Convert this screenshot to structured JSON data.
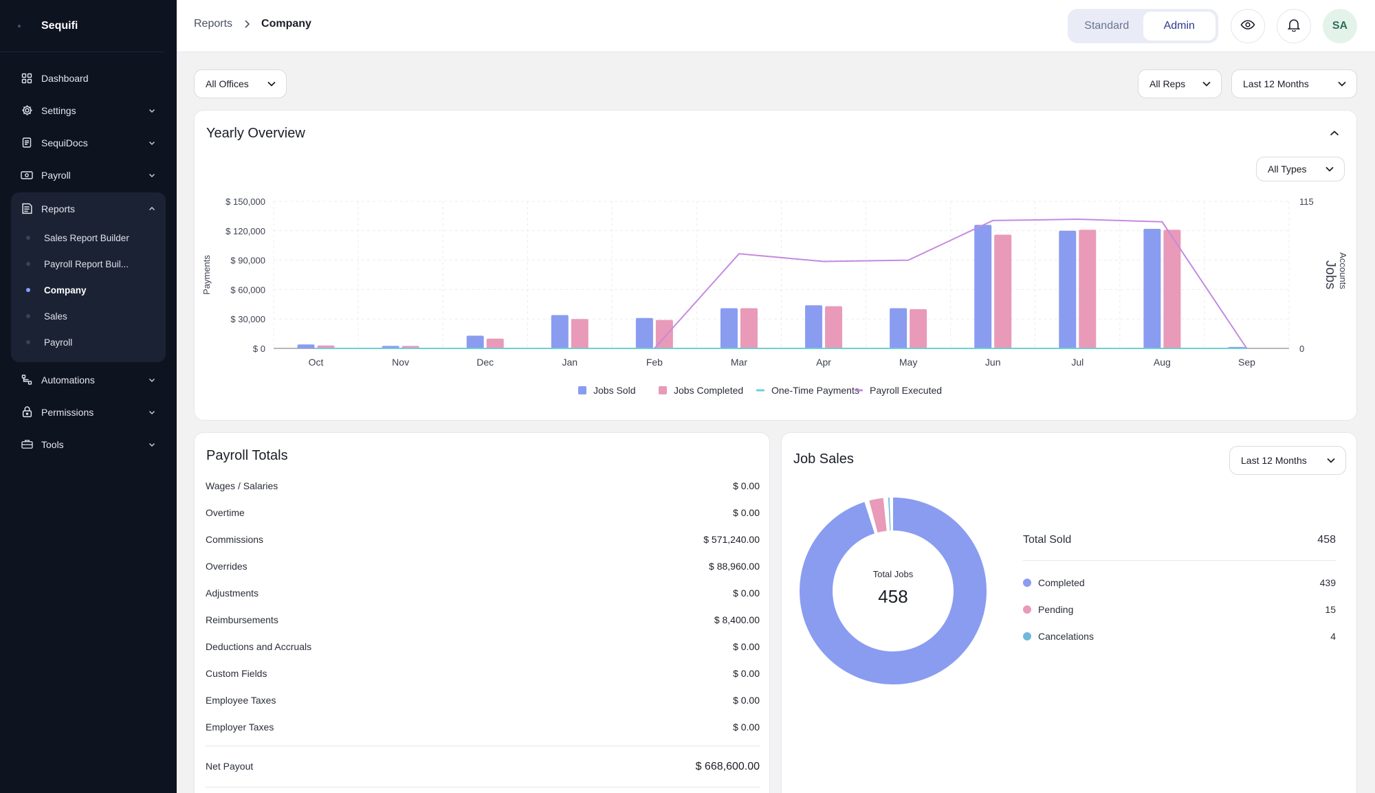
{
  "app": {
    "name": "Sequifi"
  },
  "sidebar": {
    "items": [
      {
        "label": "Dashboard",
        "icon": "grid-icon"
      },
      {
        "label": "Settings",
        "icon": "gear-icon"
      },
      {
        "label": "SequiDocs",
        "icon": "document-icon"
      },
      {
        "label": "Payroll",
        "icon": "cash-icon"
      },
      {
        "label": "Reports",
        "icon": "report-icon"
      },
      {
        "label": "Automations",
        "icon": "flow-icon"
      },
      {
        "label": "Permissions",
        "icon": "lock-icon"
      },
      {
        "label": "Tools",
        "icon": "toolbox-icon"
      }
    ],
    "reports_sub": [
      "Sales Report Builder",
      "Payroll Report Buil...",
      "Company",
      "Sales",
      "Payroll"
    ]
  },
  "header": {
    "breadcrumb": [
      "Reports",
      "Company"
    ],
    "roles": [
      "Standard",
      "Admin"
    ],
    "active_role": "Admin",
    "avatar_initials": "SA"
  },
  "filters": {
    "offices": "All Offices",
    "reps": "All Reps",
    "period": "Last 12 Months"
  },
  "yearly": {
    "title": "Yearly Overview",
    "type_filter": "All Types"
  },
  "chart_data": {
    "type": "bar",
    "categories": [
      "Oct",
      "Nov",
      "Dec",
      "Jan",
      "Feb",
      "Mar",
      "Apr",
      "May",
      "Jun",
      "Jul",
      "Aug",
      "Sep"
    ],
    "series": [
      {
        "name": "Jobs Sold",
        "kind": "bar",
        "axis": "left",
        "values": [
          4000,
          2500,
          13000,
          34000,
          31000,
          41000,
          44000,
          41000,
          126000,
          120000,
          122000,
          1500
        ],
        "color": "#8a9cf0"
      },
      {
        "name": "Jobs Completed",
        "kind": "bar",
        "axis": "left",
        "values": [
          3000,
          2500,
          10000,
          30000,
          29000,
          41000,
          43000,
          40000,
          116000,
          121000,
          121000,
          0
        ],
        "color": "#e89ab8"
      },
      {
        "name": "One-Time Payments",
        "kind": "line",
        "axis": "right",
        "values": [
          0,
          0,
          0,
          0,
          0,
          0,
          0,
          0,
          0,
          0,
          0,
          0
        ],
        "color": "#6ccfd9"
      },
      {
        "name": "Payroll Executed",
        "kind": "line",
        "axis": "right",
        "values": [
          null,
          null,
          null,
          null,
          0,
          74,
          68,
          69,
          100,
          101,
          99,
          0
        ],
        "color": "#c48ae0"
      }
    ],
    "y_left": {
      "label": "Payments",
      "ticks": [
        "$ 0",
        "$ 30,000",
        "$ 60,000",
        "$ 90,000",
        "$ 120,000",
        "$ 150,000"
      ],
      "range": [
        0,
        150000
      ]
    },
    "y_right": {
      "label": "Accounts",
      "label2": "Jobs",
      "ticks": [
        "0",
        "115"
      ],
      "range": [
        0,
        115
      ]
    },
    "grid": true,
    "legend_position": "bottom"
  },
  "payroll_totals": {
    "title": "Payroll Totals",
    "rows": [
      {
        "label": "Wages / Salaries",
        "value": "$ 0.00"
      },
      {
        "label": "Overtime",
        "value": "$ 0.00"
      },
      {
        "label": "Commissions",
        "value": "$ 571,240.00"
      },
      {
        "label": "Overrides",
        "value": "$ 88,960.00"
      },
      {
        "label": "Adjustments",
        "value": "$ 0.00"
      },
      {
        "label": "Reimbursements",
        "value": "$ 8,400.00"
      },
      {
        "label": "Deductions and Accruals",
        "value": "$ 0.00"
      },
      {
        "label": "Custom Fields",
        "value": "$ 0.00"
      },
      {
        "label": "Employee Taxes",
        "value": "$ 0.00"
      },
      {
        "label": "Employer Taxes",
        "value": "$ 0.00"
      }
    ],
    "net_label": "Net Payout",
    "net_value": "$ 668,600.00"
  },
  "job_sales": {
    "title": "Job Sales",
    "period": "Last 12 Months",
    "center_label": "Total Jobs",
    "center_value": "458",
    "total_label": "Total Sold",
    "total_value": "458",
    "segments": [
      {
        "name": "Completed",
        "value": 439,
        "color": "#8a9cf0"
      },
      {
        "name": "Pending",
        "value": 15,
        "color": "#e89ab8"
      },
      {
        "name": "Cancelations",
        "value": 4,
        "color": "#6fb8dc"
      }
    ]
  }
}
